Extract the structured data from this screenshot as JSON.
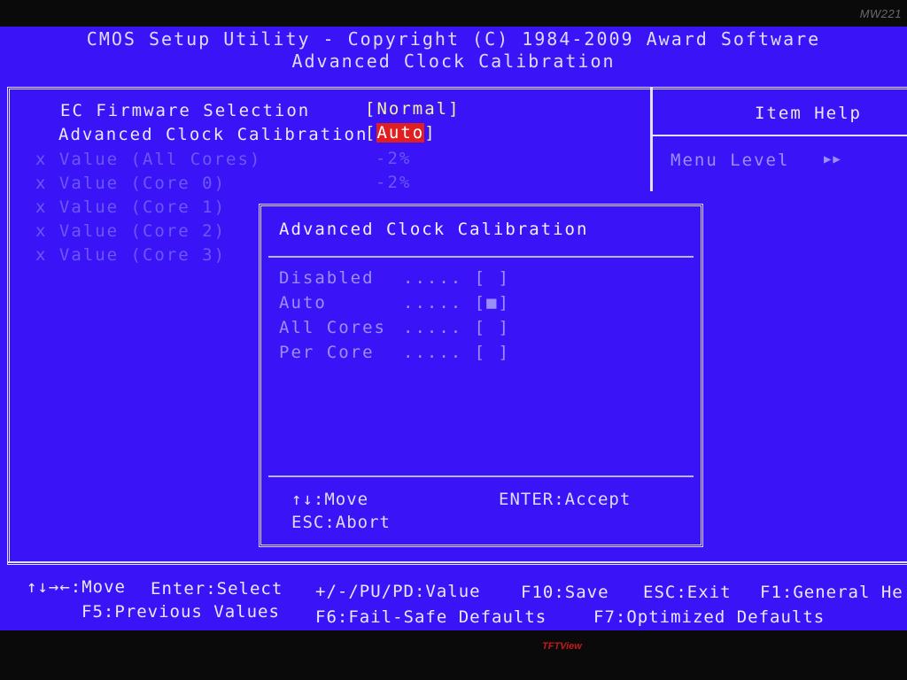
{
  "monitor": {
    "model_label": "MW221",
    "brand_label": "TFTView"
  },
  "header": {
    "line1": "CMOS Setup Utility - Copyright (C) 1984-2009 Award Software",
    "line2": "Advanced Clock Calibration"
  },
  "settings": [
    {
      "label": "EC Firmware Selection",
      "value": "Normal",
      "disabled": false
    },
    {
      "label": "Advanced Clock Calibration",
      "value": "Auto",
      "disabled": false,
      "selected": true
    },
    {
      "prefix": "x",
      "label": "Value (All Cores)",
      "value": "-2%",
      "disabled": true
    },
    {
      "prefix": "x",
      "label": "Value (Core 0)",
      "value": "-2%",
      "disabled": true
    },
    {
      "prefix": "x",
      "label": "Value (Core 1)",
      "value": "",
      "disabled": true
    },
    {
      "prefix": "x",
      "label": "Value (Core 2)",
      "value": "",
      "disabled": true
    },
    {
      "prefix": "x",
      "label": "Value (Core 3)",
      "value": "",
      "disabled": true
    }
  ],
  "help": {
    "title": "Item Help",
    "menu_level_label": "Menu Level",
    "menu_level_arrows": "▶▶"
  },
  "popup": {
    "title": "Advanced Clock Calibration",
    "dots": ".....",
    "options": [
      {
        "label": "Disabled",
        "mark": "[ ]",
        "checked": false
      },
      {
        "label": "Auto",
        "mark": "[■]",
        "checked": true
      },
      {
        "label": "All Cores",
        "mark": "[ ]",
        "checked": false
      },
      {
        "label": "Per Core",
        "mark": "[ ]",
        "checked": false
      }
    ],
    "keys": {
      "move": "↑↓:Move",
      "accept": "ENTER:Accept",
      "abort": "ESC:Abort"
    }
  },
  "footer": {
    "line1": [
      "↑↓→←:Move",
      "Enter:Select",
      "+/-/PU/PD:Value",
      "F10:Save",
      "ESC:Exit",
      "F1:General He"
    ],
    "line2": [
      "F5:Previous Values",
      "F6:Fail-Safe Defaults",
      "F7:Optimized Defaults"
    ]
  }
}
